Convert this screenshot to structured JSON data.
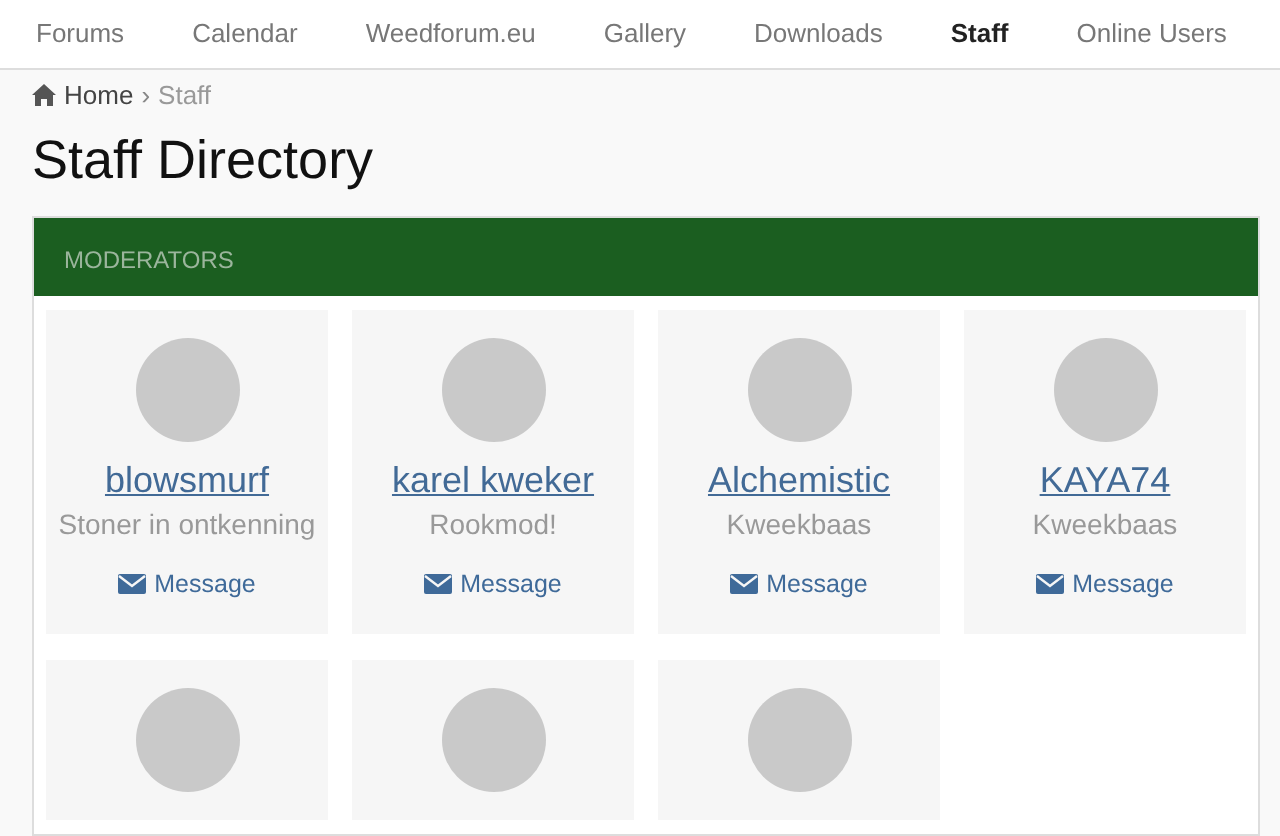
{
  "nav": [
    {
      "label": "Forums",
      "selected": false
    },
    {
      "label": "Calendar",
      "selected": false
    },
    {
      "label": "Weedforum.eu",
      "selected": false
    },
    {
      "label": "Gallery",
      "selected": false
    },
    {
      "label": "Downloads",
      "selected": false
    },
    {
      "label": "Staff",
      "selected": true
    },
    {
      "label": "Online Users",
      "selected": false
    }
  ],
  "breadcrumb": {
    "home": "Home",
    "separator": "›",
    "current": "Staff"
  },
  "title": "Staff Directory",
  "section": {
    "heading": "MODERATORS",
    "members": [
      {
        "kind": "full",
        "name": "blowsmurf",
        "role": "Stoner in ontkenning",
        "message": "Message"
      },
      {
        "kind": "full",
        "name": "karel kweker",
        "role": "Rookmod!",
        "message": "Message"
      },
      {
        "kind": "full",
        "name": "Alchemistic",
        "role": "Kweekbaas",
        "message": "Message"
      },
      {
        "kind": "full",
        "name": "KAYA74",
        "role": "Kweekbaas",
        "message": "Message"
      },
      {
        "kind": "avatar_only"
      },
      {
        "kind": "avatar_only"
      },
      {
        "kind": "avatar_only"
      }
    ]
  }
}
